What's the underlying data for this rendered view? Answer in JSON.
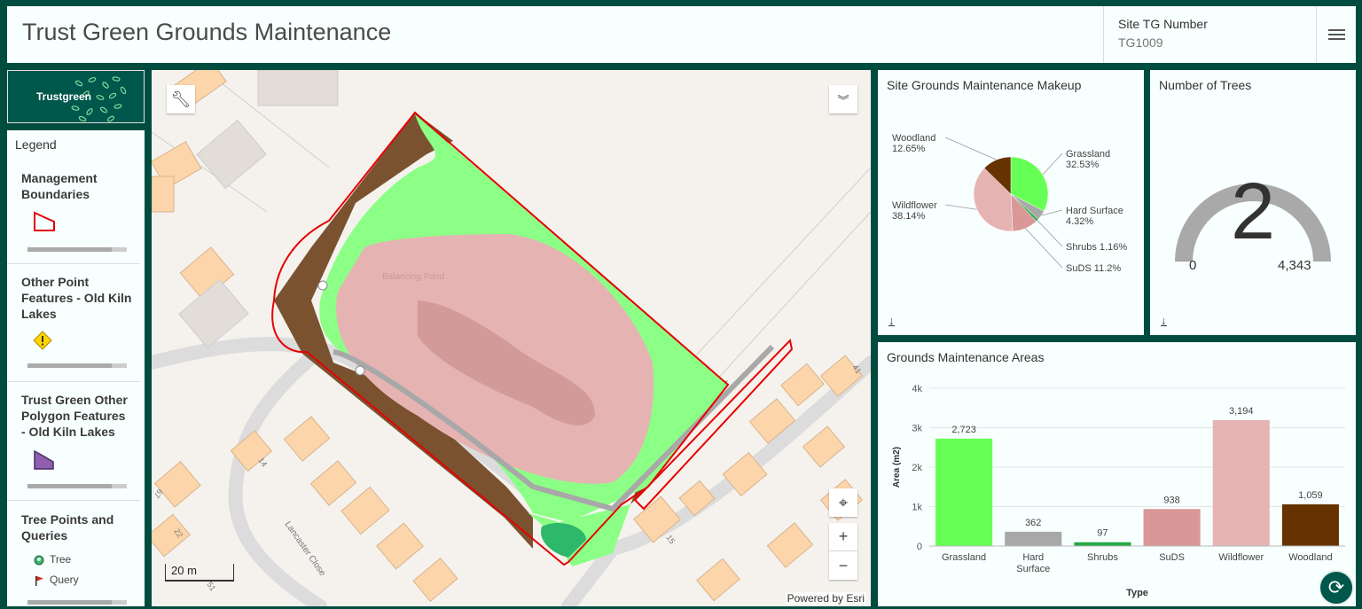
{
  "header": {
    "title": "Trust Green Grounds Maintenance",
    "site_label": "Site TG Number",
    "site_value": "TG1009"
  },
  "logo": {
    "text": "Trustgreen"
  },
  "legend": {
    "heading": "Legend",
    "sections": [
      {
        "title": "Management Boundaries"
      },
      {
        "title": "Other Point Features - Old Kiln Lakes"
      },
      {
        "title": "Trust Green Other Polygon Features - Old Kiln Lakes"
      },
      {
        "title": "Tree Points and Queries"
      }
    ],
    "tree_items": [
      "Tree",
      "Query"
    ]
  },
  "map": {
    "pond_label": "Balancing Pond",
    "street_label": "Lancaster Close",
    "house_numbers": [
      "14",
      "15",
      "67",
      "22",
      "51",
      "41"
    ],
    "scale_label": "20 m",
    "attribution": "Powered by Esri",
    "zoom_in": "+",
    "zoom_out": "−"
  },
  "pie_panel": {
    "title": "Site Grounds Maintenance Makeup",
    "chart_data": {
      "type": "pie",
      "slices": [
        {
          "label": "Grassland",
          "pct_label": "32.53%",
          "value": 32.53,
          "color": "#66ff55"
        },
        {
          "label": "Hard Surface",
          "pct_label": "4.32%",
          "value": 4.32,
          "color": "#a8a8a8"
        },
        {
          "label": "Shrubs",
          "pct_label": "1.16%",
          "value": 1.16,
          "color": "#22aa44"
        },
        {
          "label": "SuDS",
          "pct_label": "11.2%",
          "value": 11.2,
          "color": "#d99797"
        },
        {
          "label": "Wildflower",
          "pct_label": "38.14%",
          "value": 38.14,
          "color": "#e6b3b3"
        },
        {
          "label": "Woodland",
          "pct_label": "12.65%",
          "value": 12.65,
          "color": "#663300"
        }
      ]
    }
  },
  "trees_panel": {
    "title": "Number of Trees",
    "value": "2",
    "min": "0",
    "max": "4,343",
    "gauge_fraction": 0.00046
  },
  "bar_panel": {
    "title": "Grounds Maintenance Areas",
    "chart_data": {
      "type": "bar",
      "categories": [
        "Grassland",
        "Hard Surface",
        "Shrubs",
        "SuDS",
        "Wildflower",
        "Woodland"
      ],
      "category_lines": [
        [
          "Grassland"
        ],
        [
          "Hard",
          "Surface"
        ],
        [
          "Shrubs"
        ],
        [
          "SuDS"
        ],
        [
          "Wildflower"
        ],
        [
          "Woodland"
        ]
      ],
      "values": [
        2723,
        362,
        97,
        938,
        3194,
        1059
      ],
      "value_labels": [
        "2,723",
        "362",
        "97",
        "938",
        "3,194",
        "1,059"
      ],
      "colors": [
        "#66ff55",
        "#a8a8a8",
        "#22aa44",
        "#d99797",
        "#e6b3b3",
        "#663300"
      ],
      "xlabel": "Type",
      "ylabel": "Area (m2)",
      "ylim": [
        0,
        4000
      ],
      "yticks": [
        0,
        1000,
        2000,
        3000,
        4000
      ],
      "ytick_labels": [
        "0",
        "1k",
        "2k",
        "3k",
        "4k"
      ]
    }
  }
}
